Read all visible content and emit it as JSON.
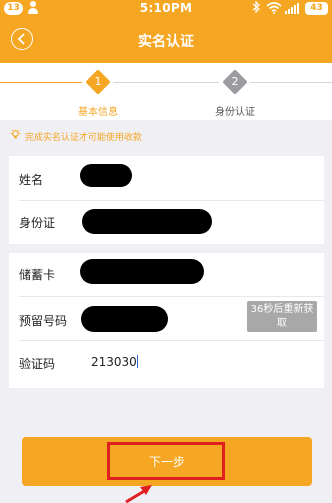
{
  "status_bar": {
    "notification_count": "13",
    "time": "5:10PM",
    "battery": "43"
  },
  "header": {
    "title": "实名认证",
    "back_icon": "chevron-left-icon"
  },
  "steps": [
    {
      "number": "1",
      "label": "基本信息",
      "state": "active",
      "color": "#f5a623"
    },
    {
      "number": "2",
      "label": "身份认证",
      "state": "inactive",
      "color": "#9b9ba0"
    }
  ],
  "tip": {
    "icon": "lightbulb-icon",
    "text": "完成实名认证才可能使用收款"
  },
  "form": {
    "name_label": "姓名",
    "id_label": "身份证",
    "card_label": "储蓄卡",
    "phone_label": "预留号码",
    "code_label": "验证码",
    "code_value": "213030",
    "resend_label": "36秒后重新获取"
  },
  "actions": {
    "next_label": "下一步"
  },
  "colors": {
    "accent": "#f5a623",
    "highlight": "#e02020",
    "disabled": "#a8a8a8"
  }
}
